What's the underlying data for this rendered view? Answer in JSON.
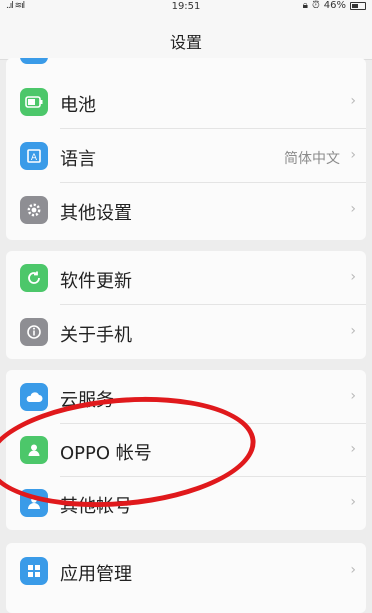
{
  "status_bar": {
    "signal": "..ıl ≋ıl",
    "time": "19:51",
    "battery_pct": "46%"
  },
  "header": {
    "title": "设置"
  },
  "groups": [
    {
      "items": [
        {
          "label": "电池",
          "icon": "battery-icon"
        },
        {
          "label": "语言",
          "value": "简体中文",
          "icon": "language-icon"
        },
        {
          "label": "其他设置",
          "icon": "gear-icon"
        }
      ]
    },
    {
      "items": [
        {
          "label": "软件更新",
          "icon": "update-icon"
        },
        {
          "label": "关于手机",
          "icon": "info-icon"
        }
      ]
    },
    {
      "items": [
        {
          "label": "云服务",
          "icon": "cloud-icon"
        },
        {
          "label": "OPPO 帐号",
          "icon": "account-icon"
        },
        {
          "label": "其他帐号",
          "icon": "accounts-icon"
        }
      ]
    },
    {
      "items": [
        {
          "label": "应用管理",
          "icon": "apps-icon"
        }
      ]
    }
  ],
  "colors": {
    "green": "#4cc76a",
    "blue": "#3a9be8",
    "gray": "#8e8e93",
    "annotation": "#e0191c"
  }
}
